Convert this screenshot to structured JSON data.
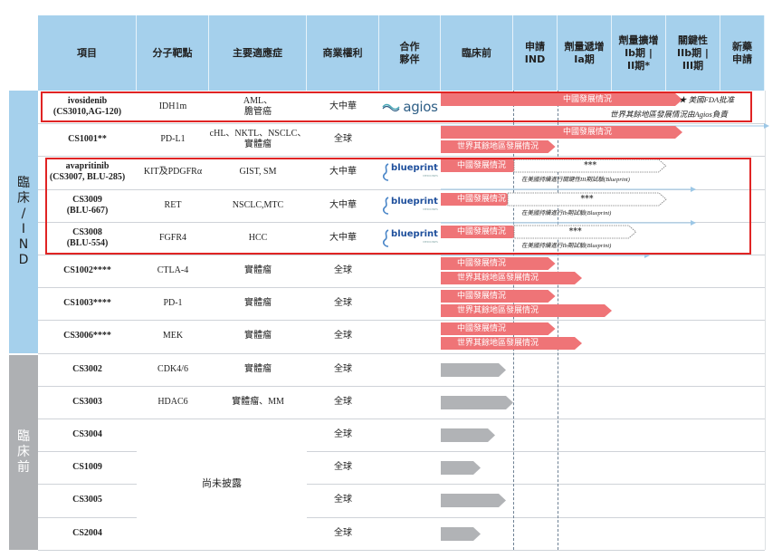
{
  "header": {
    "columns": [
      {
        "key": "project",
        "label": "項目"
      },
      {
        "key": "target",
        "label": "分子靶點"
      },
      {
        "key": "indication",
        "label": "主要適應症"
      },
      {
        "key": "rights",
        "label": "商業權利"
      },
      {
        "key": "partner",
        "label": "合作\n夥伴"
      },
      {
        "key": "preclinical",
        "label": "臨床前"
      },
      {
        "key": "ind",
        "label": "申請\nIND"
      },
      {
        "key": "phase1a",
        "label": "劑量遞增\nIa期"
      },
      {
        "key": "phase1b",
        "label": "劑量擴增\nIb期 |\nII期*"
      },
      {
        "key": "pivotal",
        "label": "關鍵性\nIIb期 |\nIII期"
      },
      {
        "key": "nda",
        "label": "新藥\n申請"
      }
    ]
  },
  "sections": [
    {
      "label_chars": [
        "臨",
        "床",
        "/",
        "I",
        "N",
        "D"
      ],
      "color": "#a5d0ec",
      "text_color": "#222"
    },
    {
      "label_chars": [
        "臨",
        "床",
        "前"
      ],
      "color": "#aeb0b3",
      "text_color": "#fff"
    }
  ],
  "colors": {
    "header_bg": "#a5d0ec",
    "bar_red": "#ef7477",
    "bar_gray": "#b1b3b6",
    "highlight": "#e02424",
    "arrow_blue": "#9cc7e6",
    "partner_agios": "#2f5f86",
    "partner_blueprint": "#1e4f9c"
  },
  "labels": {
    "china": "中國發展情況",
    "world": "世界其餘地區發展情況",
    "pending": "***",
    "undisclosed": "尚未披露",
    "fda_approved": "★ 美國FDA批准",
    "agios_note": "世界其餘地區發展情況由Agios負責",
    "bp_pivotal_note": "在美國持續進行關鍵性III期試驗(Blueprint)",
    "bp_ib_note": "在美國持續進行Ib期試驗(Blueprint)"
  },
  "partners": {
    "agios": {
      "name": "agios"
    },
    "blueprint": {
      "name": "blueprint",
      "sub": "MEDICINES"
    }
  },
  "rows": [
    {
      "project": "ivosidenib\n(CS3010,AG-120)",
      "target": "IDH1m",
      "indication": "AML、\n膽管癌",
      "rights": "大中華",
      "partner": "agios",
      "section": 0
    },
    {
      "project": "CS1001**",
      "target": "PD-L1",
      "indication": "cHL、NKTL、NSCLC、\n實體瘤",
      "rights": "全球",
      "partner": "",
      "section": 0
    },
    {
      "project": "avapritinib\n(CS3007, BLU-285)",
      "target": "KIT及PDGFRα",
      "indication": "GIST, SM",
      "rights": "大中華",
      "partner": "blueprint",
      "section": 0
    },
    {
      "project": "CS3009\n(BLU-667)",
      "target": "RET",
      "indication": "NSCLC,MTC",
      "rights": "大中華",
      "partner": "blueprint",
      "section": 0
    },
    {
      "project": "CS3008\n(BLU-554)",
      "target": "FGFR4",
      "indication": "HCC",
      "rights": "大中華",
      "partner": "blueprint",
      "section": 0
    },
    {
      "project": "CS1002****",
      "target": "CTLA-4",
      "indication": "實體瘤",
      "rights": "全球",
      "partner": "",
      "section": 0
    },
    {
      "project": "CS1003****",
      "target": "PD-1",
      "indication": "實體瘤",
      "rights": "全球",
      "partner": "",
      "section": 0
    },
    {
      "project": "CS3006****",
      "target": "MEK",
      "indication": "實體瘤",
      "rights": "全球",
      "partner": "",
      "section": 0
    },
    {
      "project": "CS3002",
      "target": "CDK4/6",
      "indication": "實體瘤",
      "rights": "全球",
      "partner": "",
      "section": 1
    },
    {
      "project": "CS3003",
      "target": "HDAC6",
      "indication": "實體瘤、MM",
      "rights": "全球",
      "partner": "",
      "section": 1
    },
    {
      "project": "CS3004",
      "target": "",
      "indication": "",
      "rights": "全球",
      "partner": "",
      "section": 1
    },
    {
      "project": "CS1009",
      "target": "",
      "indication": "",
      "rights": "全球",
      "partner": "",
      "section": 1
    },
    {
      "project": "CS3005",
      "target": "",
      "indication": "",
      "rights": "全球",
      "partner": "",
      "section": 1
    },
    {
      "project": "CS2004",
      "target": "",
      "indication": "",
      "rights": "全球",
      "partner": "",
      "section": 1
    }
  ],
  "progress": [
    {
      "row": 0,
      "bars": [
        {
          "kind": "red",
          "label": "china",
          "stage_end": 4.3
        }
      ],
      "notes": [
        "fda_approved",
        "agios_note"
      ],
      "blue_arrow_end": 6.0
    },
    {
      "row": 1,
      "bars": [
        {
          "kind": "red",
          "label": "china",
          "stage_end": 4.3
        },
        {
          "kind": "red",
          "label": "world",
          "stage_end": 1.95
        }
      ]
    },
    {
      "row": 2,
      "bars": [
        {
          "kind": "red",
          "label": "china",
          "stage_end": 1.15
        },
        {
          "kind": "outline",
          "label": "pending",
          "stage_end": 4.0
        }
      ],
      "notes": [
        "bp_pivotal_note"
      ],
      "blue_arrow_end": 4.55
    },
    {
      "row": 3,
      "bars": [
        {
          "kind": "red",
          "label": "china",
          "stage_end": 1.0
        },
        {
          "kind": "outline",
          "label": "pending",
          "stage_end": 4.0
        }
      ],
      "notes": [
        "bp_ib_note"
      ],
      "blue_arrow_end": 4.55
    },
    {
      "row": 4,
      "bars": [
        {
          "kind": "red",
          "label": "china",
          "stage_end": 1.15
        },
        {
          "kind": "outline",
          "label": "pending",
          "stage_end": 3.45
        }
      ],
      "notes": [
        "bp_ib_note"
      ],
      "blue_arrow_end": 3.7
    },
    {
      "row": 5,
      "bars": [
        {
          "kind": "red",
          "label": "china",
          "stage_end": 1.95
        },
        {
          "kind": "red",
          "label": "world",
          "stage_end": 2.45
        }
      ]
    },
    {
      "row": 6,
      "bars": [
        {
          "kind": "red",
          "label": "china",
          "stage_end": 1.95
        },
        {
          "kind": "red",
          "label": "world",
          "stage_end": 3.0
        }
      ]
    },
    {
      "row": 7,
      "bars": [
        {
          "kind": "red",
          "label": "china",
          "stage_end": 1.95
        },
        {
          "kind": "red",
          "label": "world",
          "stage_end": 2.45
        }
      ]
    },
    {
      "row": 8,
      "bars": [
        {
          "kind": "gray",
          "stage_end": 0.9
        }
      ]
    },
    {
      "row": 9,
      "bars": [
        {
          "kind": "gray",
          "stage_end": 1.0
        }
      ]
    },
    {
      "row": 10,
      "bars": [
        {
          "kind": "gray",
          "stage_end": 0.75
        }
      ]
    },
    {
      "row": 11,
      "bars": [
        {
          "kind": "gray",
          "stage_end": 0.55
        }
      ]
    },
    {
      "row": 12,
      "bars": [
        {
          "kind": "gray",
          "stage_end": 0.9
        }
      ]
    },
    {
      "row": 13,
      "bars": [
        {
          "kind": "gray",
          "stage_end": 0.55
        }
      ]
    }
  ],
  "highlight_groups": [
    {
      "rows": [
        0,
        0
      ]
    },
    {
      "rows": [
        2,
        4
      ]
    }
  ]
}
